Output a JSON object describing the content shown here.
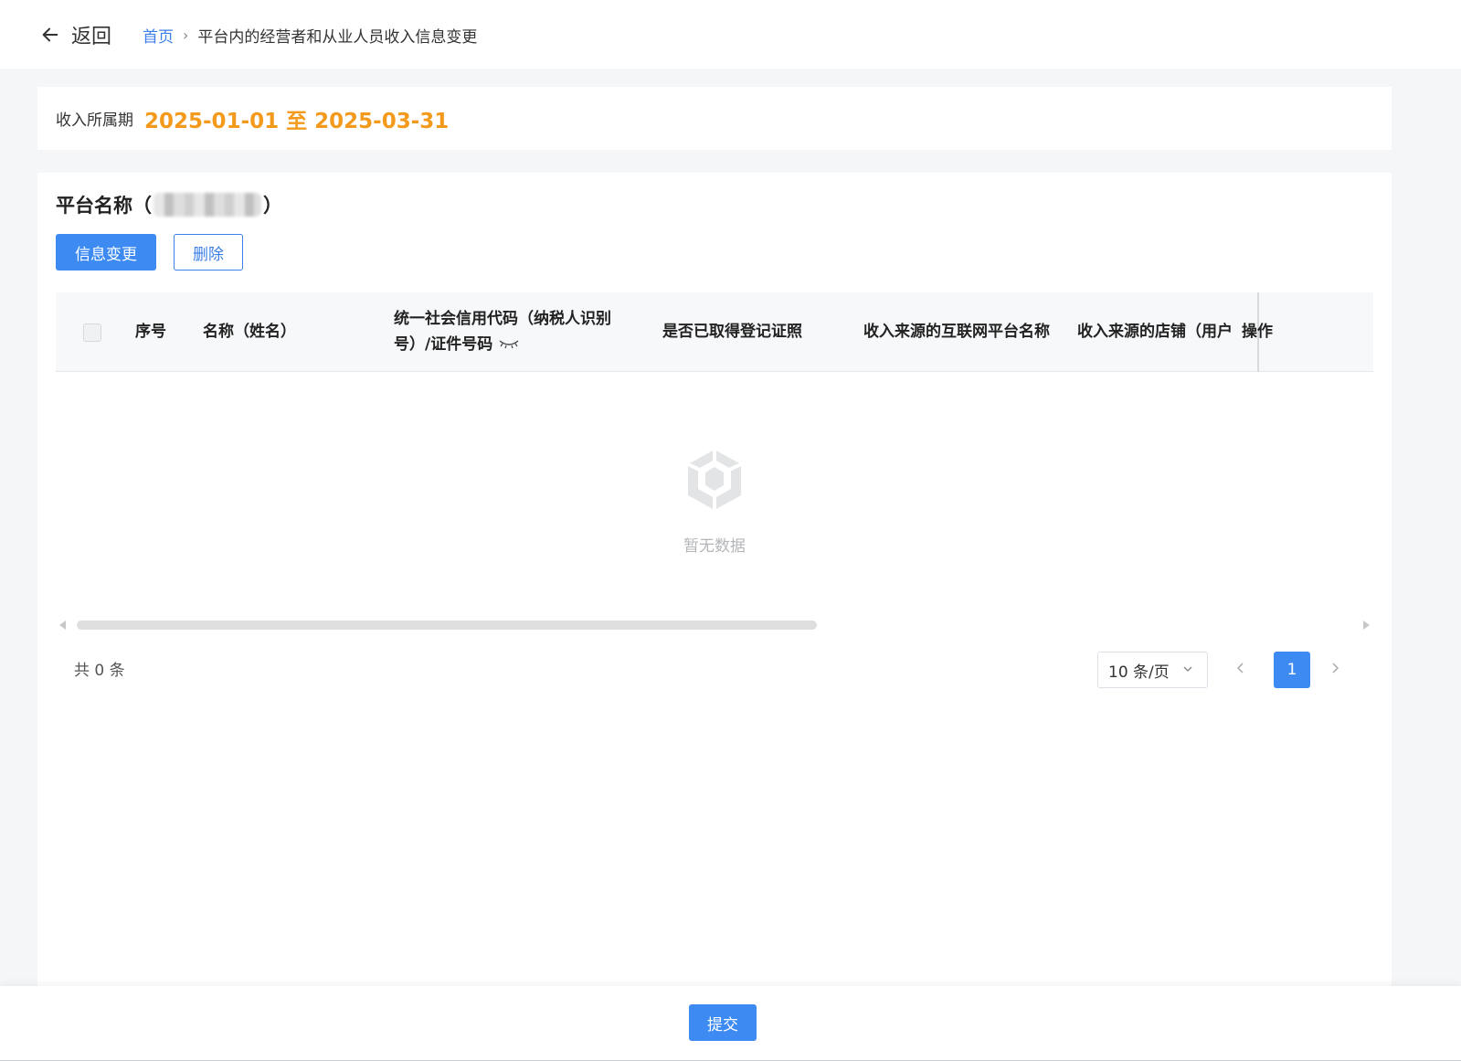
{
  "header": {
    "back_label": "返回",
    "breadcrumb": {
      "home": "首页",
      "current": "平台内的经营者和从业人员收入信息变更"
    }
  },
  "period": {
    "label": "收入所属期",
    "value": "2025-01-01 至 2025-03-31"
  },
  "platform": {
    "title_prefix": "平台名称（",
    "title_suffix": "）",
    "name_redacted": true
  },
  "actions": {
    "change_label": "信息变更",
    "delete_label": "删除"
  },
  "table": {
    "columns": [
      "序号",
      "名称（姓名）",
      "统一社会信用代码（纳税人识别号）/证件号码",
      "是否已取得登记证照",
      "收入来源的互联网平台名称",
      "收入来源的店铺（用户",
      "操作"
    ],
    "col3_line1": "统一社会信用代码（纳税人识别",
    "col3_line2": "号）/证件号码",
    "rows": [],
    "empty_text": "暂无数据"
  },
  "pagination": {
    "total_text": "共 0 条",
    "page_size": "10 条/页",
    "current_page": "1"
  },
  "footer": {
    "submit_label": "提交"
  },
  "colors": {
    "primary": "#3d8bf2",
    "accent_orange": "#f39a1c",
    "link": "#3d7ee8"
  },
  "icons": [
    "arrow-left-icon",
    "chevron-right-icon",
    "eye-closed-icon",
    "empty-box-icon",
    "chevron-down-icon",
    "chevron-left-icon"
  ]
}
